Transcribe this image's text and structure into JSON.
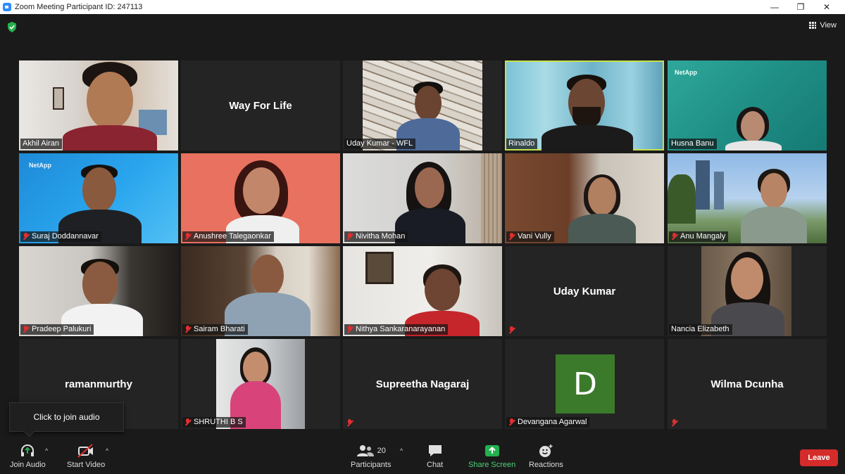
{
  "window": {
    "title": "Zoom Meeting Participant ID: 247113",
    "minimize": "—",
    "restore": "❐",
    "close": "✕"
  },
  "view_button": {
    "label": "View"
  },
  "tooltip": {
    "text": "Click to join audio"
  },
  "participants": [
    {
      "name": "Akhil Airan",
      "muted": false,
      "video": true
    },
    {
      "name": "Way For Life",
      "muted": false,
      "video": false,
      "display_text": "Way For Life"
    },
    {
      "name": "Uday Kumar - WFL",
      "muted": false,
      "video": true
    },
    {
      "name": "Rinaldo",
      "muted": false,
      "video": true,
      "active_speaker": true
    },
    {
      "name": "Husna Banu",
      "muted": false,
      "video": true,
      "background_brand": "NetApp"
    },
    {
      "name": "Suraj Doddannavar",
      "muted": true,
      "video": true,
      "background_brand": "NetApp"
    },
    {
      "name": "Anushree Talegaonkar",
      "muted": true,
      "video": true
    },
    {
      "name": "Nivitha Mohan",
      "muted": true,
      "video": true
    },
    {
      "name": "Vani Vully",
      "muted": true,
      "video": true
    },
    {
      "name": "Anu Mangaly",
      "muted": true,
      "video": true
    },
    {
      "name": "Pradeep Palukuri",
      "muted": true,
      "video": true
    },
    {
      "name": "Sairam Bharati",
      "muted": true,
      "video": true
    },
    {
      "name": "Nithya Sankaranarayanan",
      "muted": true,
      "video": true
    },
    {
      "name": "",
      "muted": true,
      "video": false,
      "display_text": "Uday Kumar"
    },
    {
      "name": "Nancia Elizabeth",
      "muted": false,
      "video": true
    },
    {
      "name": "",
      "muted": false,
      "video": false,
      "display_text": "ramanmurthy"
    },
    {
      "name": "SHRUTHI B S",
      "muted": true,
      "video": true
    },
    {
      "name": "",
      "muted": true,
      "video": false,
      "display_text": "Supreetha Nagaraj"
    },
    {
      "name": "Devangana Agarwal",
      "muted": true,
      "video": false,
      "avatar_letter": "D"
    },
    {
      "name": "",
      "muted": true,
      "video": false,
      "display_text": "Wilma Dcunha"
    }
  ],
  "toolbar": {
    "join_audio": "Join Audio",
    "start_video": "Start Video",
    "participants": "Participants",
    "participants_count": "20",
    "chat": "Chat",
    "share_screen": "Share Screen",
    "reactions": "Reactions",
    "leave": "Leave",
    "caret": "^"
  },
  "colors": {
    "active_speaker_border": "#c8e04a",
    "share_screen_green": "#23b14d",
    "leave_red": "#d42b2b",
    "muted_red": "#e02f2f",
    "avatar_green": "#3c7a2b"
  }
}
